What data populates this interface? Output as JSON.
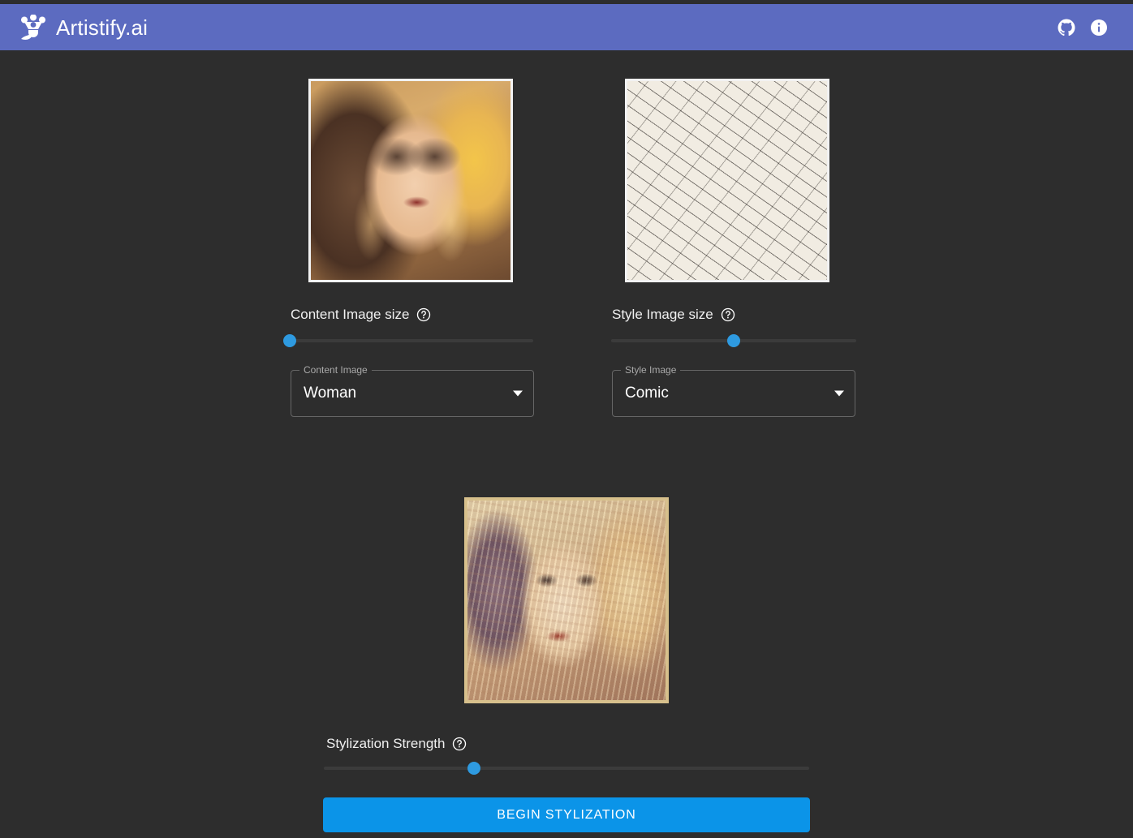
{
  "app": {
    "brand_name": "Artistify.ai",
    "logo_icon": "paint-palette-brush-icon",
    "header_color": "#5c6bc0",
    "background_color": "#2d2d2d",
    "accent_color": "#0b94e8",
    "slider_thumb_color": "#2e9ae0"
  },
  "header": {
    "actions": [
      {
        "name": "github-link",
        "icon": "github-icon",
        "label": "GitHub"
      },
      {
        "name": "info-button",
        "icon": "info-icon",
        "label": "Info"
      }
    ]
  },
  "content_panel": {
    "image_alt": "Portrait photo of a blonde woman",
    "slider": {
      "label": "Content Image size",
      "help_icon": "help-circle-icon",
      "value_percent": 0
    },
    "select": {
      "legend": "Content Image",
      "value": "Woman",
      "arrow_icon": "chevron-down-icon"
    }
  },
  "style_panel": {
    "image_alt": "Abstract expressionist painting",
    "slider": {
      "label": "Style Image size",
      "help_icon": "help-circle-icon",
      "value_percent": 50
    },
    "select": {
      "legend": "Style Image",
      "value": "Comic",
      "arrow_icon": "chevron-down-icon"
    }
  },
  "result": {
    "image_alt": "Stylized portrait result",
    "slider": {
      "label": "Stylization Strength",
      "help_icon": "help-circle-icon",
      "value_percent": 31
    },
    "action_button": {
      "label": "BEGIN STYLIZATION"
    }
  }
}
